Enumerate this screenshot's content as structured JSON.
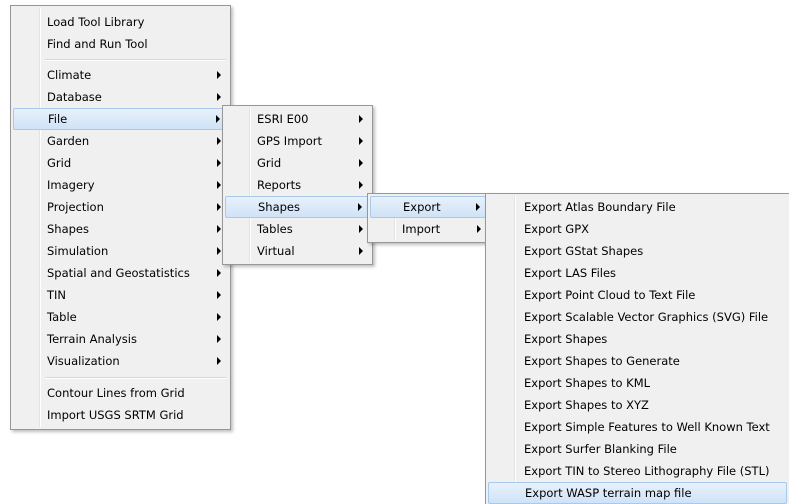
{
  "main_menu": {
    "top_items": [
      {
        "label": "Load Tool Library"
      },
      {
        "label": "Find and Run Tool"
      }
    ],
    "category_items": [
      {
        "label": "Climate"
      },
      {
        "label": "Database"
      },
      {
        "label": "File"
      },
      {
        "label": "Garden"
      },
      {
        "label": "Grid"
      },
      {
        "label": "Imagery"
      },
      {
        "label": "Projection"
      },
      {
        "label": "Shapes"
      },
      {
        "label": "Simulation"
      },
      {
        "label": "Spatial and Geostatistics"
      },
      {
        "label": "TIN"
      },
      {
        "label": "Table"
      },
      {
        "label": "Terrain Analysis"
      },
      {
        "label": "Visualization"
      }
    ],
    "bottom_items": [
      {
        "label": "Contour Lines from Grid"
      },
      {
        "label": "Import USGS SRTM Grid"
      }
    ]
  },
  "file_menu": {
    "items": [
      {
        "label": "ESRI E00"
      },
      {
        "label": "GPS Import"
      },
      {
        "label": "Grid"
      },
      {
        "label": "Reports"
      },
      {
        "label": "Shapes"
      },
      {
        "label": "Tables"
      },
      {
        "label": "Virtual"
      }
    ]
  },
  "shapes_menu": {
    "items": [
      {
        "label": "Export"
      },
      {
        "label": "Import"
      }
    ]
  },
  "export_menu": {
    "items": [
      {
        "label": "Export Atlas Boundary File"
      },
      {
        "label": "Export GPX"
      },
      {
        "label": "Export GStat Shapes"
      },
      {
        "label": "Export LAS Files"
      },
      {
        "label": "Export Point Cloud to Text File"
      },
      {
        "label": "Export Scalable Vector Graphics (SVG) File"
      },
      {
        "label": "Export Shapes"
      },
      {
        "label": "Export Shapes to Generate"
      },
      {
        "label": "Export Shapes to KML"
      },
      {
        "label": "Export Shapes to XYZ"
      },
      {
        "label": "Export Simple Features to Well Known Text"
      },
      {
        "label": "Export Surfer Blanking File"
      },
      {
        "label": "Export TIN to Stereo Lithography File (STL)"
      },
      {
        "label": "Export WASP terrain map file"
      }
    ]
  }
}
